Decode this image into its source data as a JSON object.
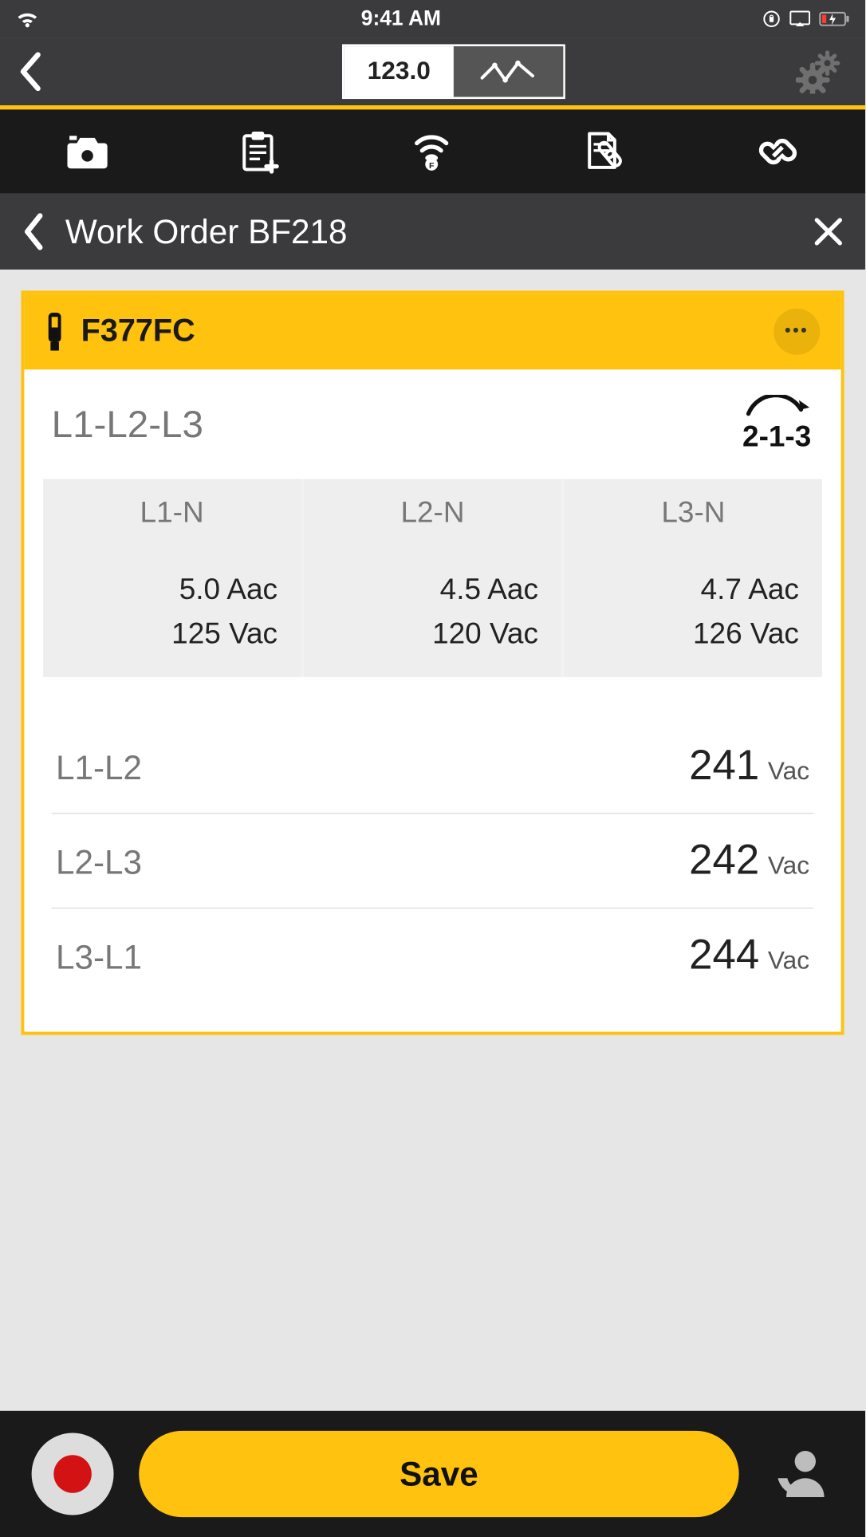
{
  "status": {
    "time": "9:41 AM"
  },
  "topnav": {
    "mode_numeric": "123.0"
  },
  "crumb": {
    "title": "Work Order BF218"
  },
  "device": {
    "name": "F377FC"
  },
  "phase": {
    "label": "L1-L2-L3",
    "rotation": "2-1-3"
  },
  "table": {
    "headers": [
      "L1-N",
      "L2-N",
      "L3-N"
    ],
    "cells": [
      {
        "amps": "5.0 Aac",
        "volts": "125 Vac"
      },
      {
        "amps": "4.5 Aac",
        "volts": "120 Vac"
      },
      {
        "amps": "4.7 Aac",
        "volts": "126 Vac"
      }
    ]
  },
  "rows": [
    {
      "label": "L1-L2",
      "value": "241",
      "unit": "Vac"
    },
    {
      "label": "L2-L3",
      "value": "242",
      "unit": "Vac"
    },
    {
      "label": "L3-L1",
      "value": "244",
      "unit": "Vac"
    }
  ],
  "bottom": {
    "save": "Save"
  }
}
